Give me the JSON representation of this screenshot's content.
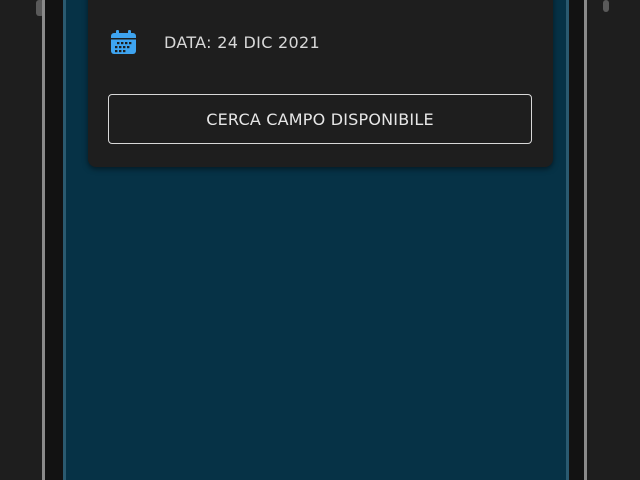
{
  "booking": {
    "date_label": "DATA: 24 DIC 2021",
    "search_button_label": "CERCA CAMPO DISPONIBILE"
  },
  "icons": {
    "date": "calendar-icon"
  },
  "colors": {
    "screen_background": "#063246",
    "card_background": "#1e1e1e",
    "calendar_icon": "#3ea4f0",
    "text": "#d8d8d8"
  }
}
